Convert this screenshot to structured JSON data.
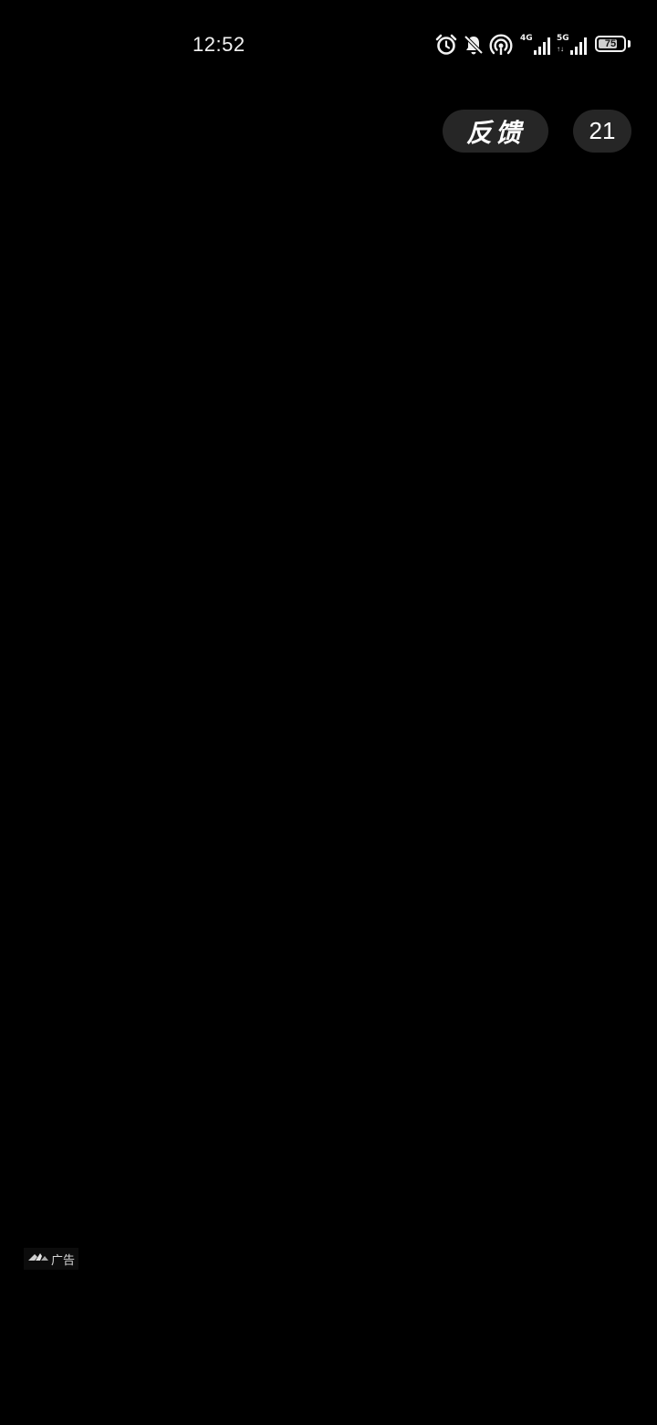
{
  "status_bar": {
    "time": "12:52",
    "network_1": "4G",
    "network_2": "5G",
    "sim_1": "1",
    "arrows": "↑↓",
    "battery": "75",
    "battery_level": 0.75,
    "icons": [
      "alarm-icon",
      "bell-off-icon",
      "hotspot-icon",
      "signal-icon",
      "signal-icon",
      "battery-icon"
    ]
  },
  "top_controls": {
    "feedback_label": "反馈",
    "countdown": "21"
  },
  "ad": {
    "label": "广告",
    "logo_icon": "ad-network-logo-icon"
  },
  "colors": {
    "background": "#000000",
    "pill_background": "#262626",
    "text": "#ffffff"
  }
}
